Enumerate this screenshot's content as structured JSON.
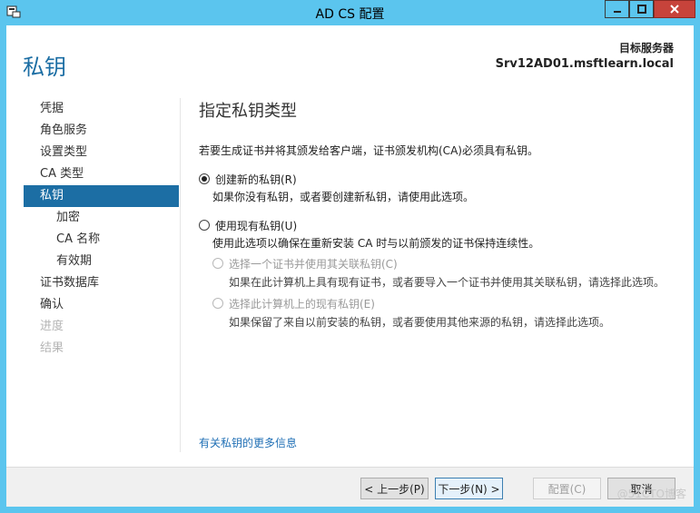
{
  "window": {
    "title": "AD CS 配置"
  },
  "header": {
    "page_title": "私钥",
    "target_label": "目标服务器",
    "target_value": "Srv12AD01.msftlearn.local"
  },
  "nav": {
    "items": [
      {
        "label": "凭据",
        "state": "normal",
        "level": 0
      },
      {
        "label": "角色服务",
        "state": "normal",
        "level": 0
      },
      {
        "label": "设置类型",
        "state": "normal",
        "level": 0
      },
      {
        "label": "CA 类型",
        "state": "normal",
        "level": 0
      },
      {
        "label": "私钥",
        "state": "active",
        "level": 0
      },
      {
        "label": "加密",
        "state": "normal",
        "level": 1
      },
      {
        "label": "CA 名称",
        "state": "normal",
        "level": 1
      },
      {
        "label": "有效期",
        "state": "normal",
        "level": 1
      },
      {
        "label": "证书数据库",
        "state": "normal",
        "level": 0
      },
      {
        "label": "确认",
        "state": "normal",
        "level": 0
      },
      {
        "label": "进度",
        "state": "disabled",
        "level": 0
      },
      {
        "label": "结果",
        "state": "disabled",
        "level": 0
      }
    ]
  },
  "content": {
    "section_title": "指定私钥类型",
    "intro": "若要生成证书并将其颁发给客户端，证书颁发机构(CA)必须具有私钥。",
    "option_new": {
      "label": "创建新的私钥(R)",
      "desc": "如果你没有私钥，或者要创建新私钥，请使用此选项。",
      "checked": true
    },
    "option_existing": {
      "label": "使用现有私钥(U)",
      "desc": "使用此选项以确保在重新安装 CA 时与以前颁发的证书保持连续性。",
      "checked": false
    },
    "sub_option_cert": {
      "label": "选择一个证书并使用其关联私钥(C)",
      "desc": "如果在此计算机上具有现有证书，或者要导入一个证书并使用其关联私钥，请选择此选项。"
    },
    "sub_option_key": {
      "label": "选择此计算机上的现有私钥(E)",
      "desc": "如果保留了来自以前安装的私钥，或者要使用其他来源的私钥，请选择此选项。"
    },
    "more_link": "有关私钥的更多信息"
  },
  "footer": {
    "prev": "< 上一步(P)",
    "next": "下一步(N) >",
    "configure": "配置(C)",
    "cancel": "取消"
  },
  "watermark": "@51CTO博客",
  "colors": {
    "titlebar": "#5bc5ee",
    "accent": "#1c6ea4",
    "link": "#1f6fb5",
    "close": "#c7433b"
  }
}
